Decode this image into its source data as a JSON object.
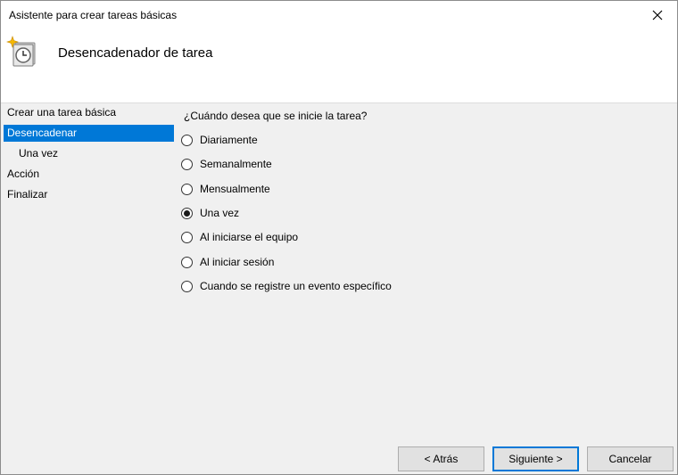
{
  "window": {
    "title": "Asistente para crear tareas básicas",
    "close_glyph": "✕"
  },
  "header": {
    "title": "Desencadenador de tarea",
    "icon": "task-scheduler-clock-icon"
  },
  "sidebar": {
    "items": [
      {
        "label": "Crear una tarea básica",
        "active": false,
        "sub": false
      },
      {
        "label": "Desencadenar",
        "active": true,
        "sub": false
      },
      {
        "label": "Una vez",
        "active": false,
        "sub": true
      },
      {
        "label": "Acción",
        "active": false,
        "sub": false
      },
      {
        "label": "Finalizar",
        "active": false,
        "sub": false
      }
    ]
  },
  "content": {
    "question": "¿Cuándo desea que se inicie la tarea?",
    "options": [
      {
        "label": "Diariamente",
        "selected": false
      },
      {
        "label": "Semanalmente",
        "selected": false
      },
      {
        "label": "Mensualmente",
        "selected": false
      },
      {
        "label": "Una vez",
        "selected": true
      },
      {
        "label": "Al iniciarse el equipo",
        "selected": false
      },
      {
        "label": "Al iniciar sesión",
        "selected": false
      },
      {
        "label": "Cuando se registre un evento específico",
        "selected": false
      }
    ]
  },
  "buttons": {
    "back": "< Atrás",
    "next": "Siguiente >",
    "cancel": "Cancelar"
  },
  "colors": {
    "accent": "#0078d7",
    "background": "#f0f0f0",
    "header": "#ffffff"
  }
}
